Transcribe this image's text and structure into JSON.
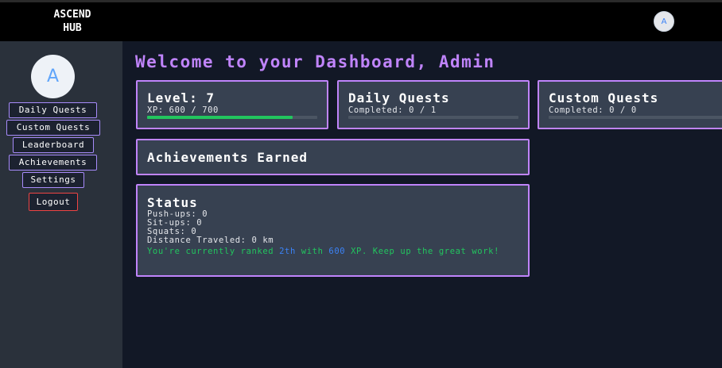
{
  "header": {
    "logo_line1": "ASCEND",
    "logo_tag": "",
    "logo_line2": "HUB",
    "avatar_initial": "A"
  },
  "sidebar": {
    "avatar_initial": "A",
    "items": [
      {
        "label": "Daily Quests"
      },
      {
        "label": "Custom Quests"
      },
      {
        "label": "Leaderboard"
      },
      {
        "label": "Achievements"
      },
      {
        "label": "Settings"
      }
    ],
    "logout_label": "Logout"
  },
  "main": {
    "title": "Welcome to your Dashboard, Admin",
    "level_card": {
      "title": "Level: 7",
      "xp_text": "XP: 600 / 700",
      "progress": 0.857
    },
    "daily_card": {
      "title": "Daily Quests",
      "completed_text": "Completed: 0 / 1",
      "progress": 0
    },
    "custom_card": {
      "title": "Custom Quests",
      "completed_text": "Completed: 0 / 0",
      "progress": 0
    },
    "achievements_card": {
      "title": "Achievements Earned"
    },
    "status_card": {
      "title": "Status",
      "pushups": "Push-ups: 0",
      "situps": "Sit-ups: 0",
      "squats": "Squats: 0",
      "distance": "Distance Traveled: 0 km",
      "rank_prefix": "You're currently ranked ",
      "rank_value": "2th",
      "rank_mid": " with ",
      "xp_value": "600",
      "rank_suffix": " XP. Keep up the great work!"
    }
  },
  "colors": {
    "accent": "#c084fc",
    "progress": "#22c55e",
    "highlight": "#3b82f6",
    "logout_border": "#ef4444"
  }
}
